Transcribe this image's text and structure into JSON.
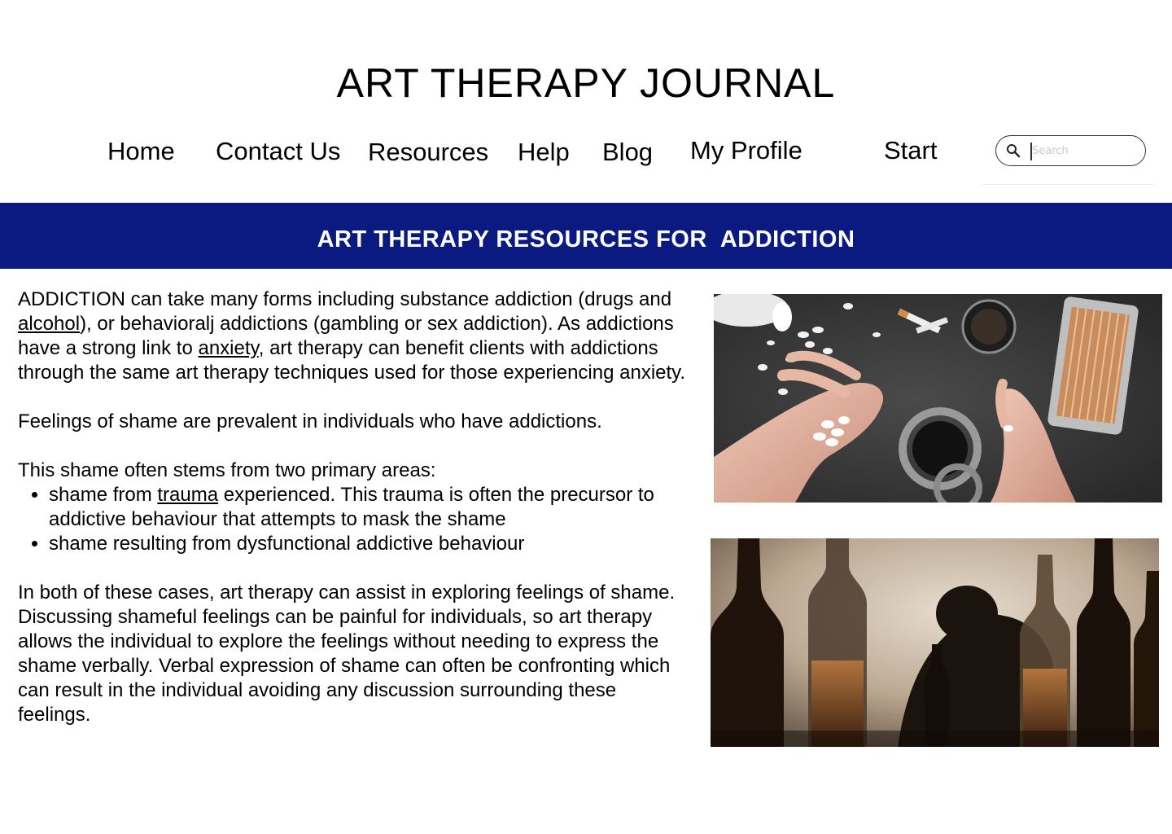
{
  "header": {
    "site_title": "ART THERAPY JOURNAL"
  },
  "nav": {
    "items": [
      {
        "label": "Home"
      },
      {
        "label": "Contact Us"
      },
      {
        "label": "Resources"
      },
      {
        "label": "Help"
      },
      {
        "label": "Blog"
      },
      {
        "label": "My Profile"
      },
      {
        "label": "Start"
      }
    ]
  },
  "search": {
    "placeholder": "Search",
    "value": "",
    "icon": "search-icon"
  },
  "banner": {
    "title": "ART THERAPY RESOURCES FOR  ADDICTION",
    "color": "#0a1a80"
  },
  "article": {
    "p1": {
      "before_alcohol": "ADDICTION can take many forms including substance addiction (drugs and ",
      "alcohol_link": "alcohol",
      "between": "), or behavioralj addictions (gambling or sex addiction).  As addictions have a strong link to ",
      "anxiety_link": "anxiety",
      "after_anxiety": ", art therapy can benefit clients with addictions through the same art therapy techniques used for those experiencing anxiety."
    },
    "p2": "Feelings of shame are prevalent in individuals who have addictions.",
    "p3": "This shame often stems from two primary areas:",
    "bullets": {
      "b1_before": "shame from ",
      "b1_link": "trauma",
      "b1_after": " experienced. This trauma is often the precursor to addictive behaviour that attempts to mask the shame",
      "b2": "shame resulting from dysfunctional addictive behaviour"
    },
    "p4": "In both of these cases, art therapy can assist in exploring feelings of shame. Discussing shameful feelings can be painful for individuals, so art therapy allows the individual to explore the feelings without needing to express the shame verbally. Verbal expression of shame can often be confronting which can result in the individual avoiding any discussion surrounding these feelings."
  },
  "images": {
    "photo1": "pills-in-hand-photo",
    "photo2": "bottles-silhouette-photo"
  }
}
